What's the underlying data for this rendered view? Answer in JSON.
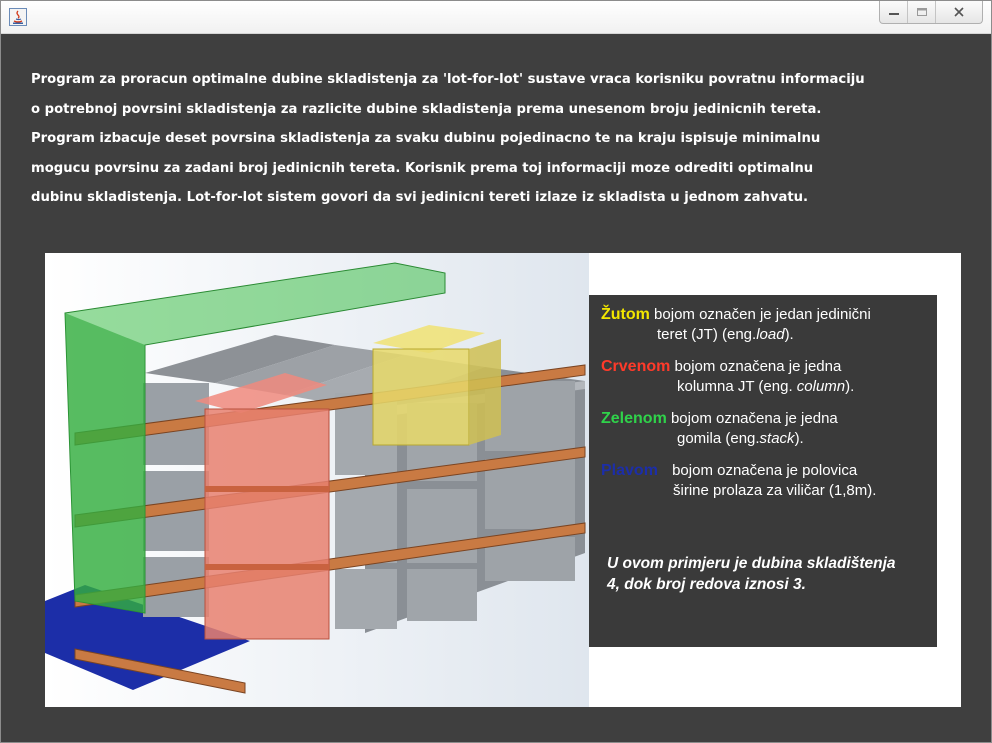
{
  "window": {
    "controls": {
      "minimize_icon": "minimize-icon",
      "maximize_icon": "maximize-icon",
      "close_icon": "close-icon"
    }
  },
  "description": {
    "lines": [
      "Program za proracun optimalne dubine skladistenja za 'lot-for-lot' sustave vraca korisniku povratnu informaciju",
      "o potrebnoj povrsini skladistenja za razlicite dubine skladistenja prema unesenom broju jedinicnih tereta.",
      "Program izbacuje deset povrsina skladistenja za svaku dubinu pojedinacno te na kraju ispisuje minimalnu",
      "mogucu povrsinu za zadani broj jedinicnih tereta. Korisnik prema toj informaciji moze odrediti optimalnu",
      "dubinu skladistenja. Lot-for-lot sistem govori da svi jedinicni tereti izlaze iz skladista u jednom zahvatu."
    ]
  },
  "legend": {
    "yellow": {
      "key": "Žutom",
      "line1": "bojom označen je jedan jedinični",
      "line2a": "teret (JT) (eng.",
      "line2b": "load",
      "line2c": ").",
      "color": "#f2e600"
    },
    "red": {
      "key": "Crvenom",
      "line1": "bojom označena je jedna",
      "line2a": "kolumna JT (eng. ",
      "line2b": "column",
      "line2c": ").",
      "color": "#ff3a2a"
    },
    "green": {
      "key": "Zelenom",
      "line1": "bojom označena je jedna",
      "line2a": "gomila (eng.",
      "line2b": "stack",
      "line2c": ").",
      "color": "#2fd24a"
    },
    "blue": {
      "key": "Plavom",
      "line1": "bojom označena je polovica",
      "line2a": "širine prolaza za viličar (1,8m).",
      "color": "#1c2ea8"
    },
    "note_line1": "U ovom primjeru je dubina skladištenja",
    "note_line2": "4, dok broj redova iznosi 3."
  }
}
